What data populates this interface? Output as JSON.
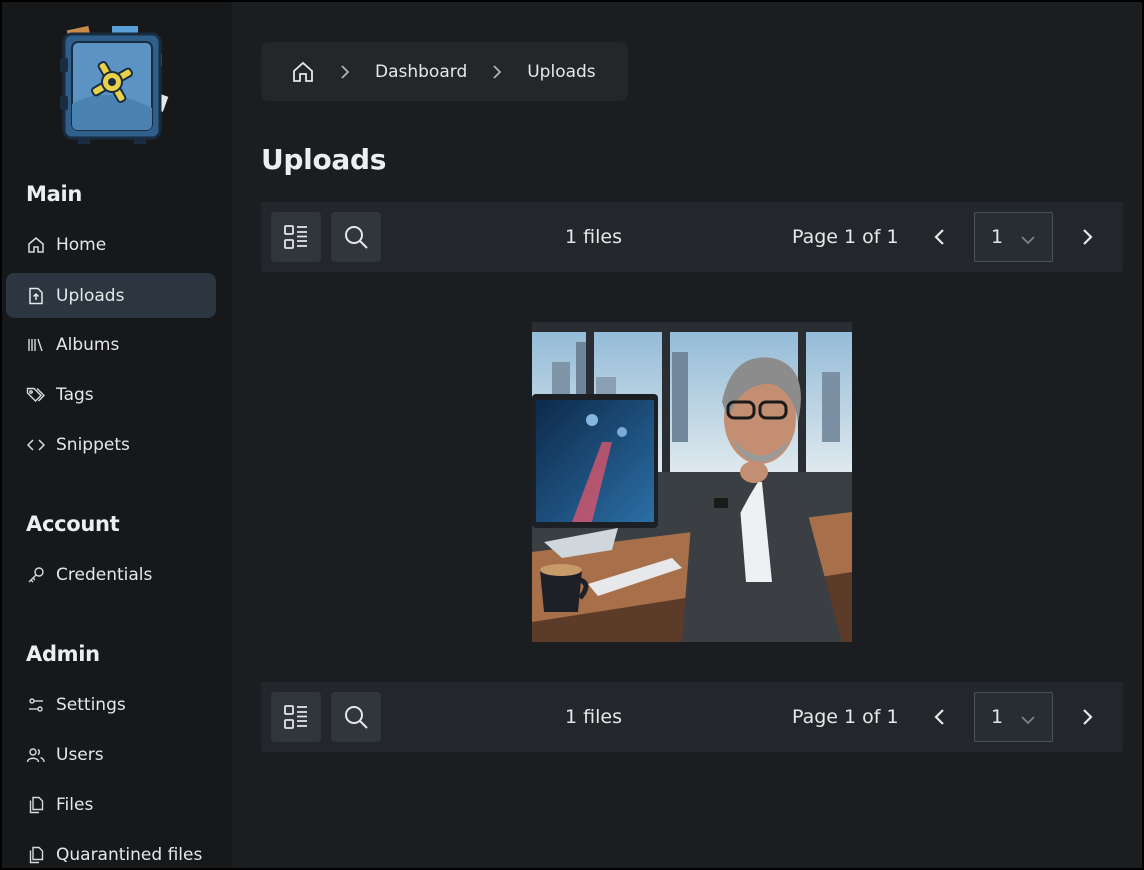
{
  "sidebar": {
    "logo": "vault-safe-logo",
    "sections": {
      "main": "Main",
      "account": "Account",
      "admin": "Admin"
    },
    "items": {
      "home": "Home",
      "uploads": "Uploads",
      "albums": "Albums",
      "tags": "Tags",
      "snippets": "Snippets",
      "credentials": "Credentials",
      "settings": "Settings",
      "users": "Users",
      "files": "Files",
      "quarantined": "Quarantined files"
    },
    "active": "uploads"
  },
  "breadcrumb": {
    "home_icon": "home-icon",
    "items": [
      "Dashboard",
      "Uploads"
    ]
  },
  "page": {
    "title": "Uploads"
  },
  "toolbar": {
    "view_icon": "list-view-icon",
    "search_icon": "search-icon",
    "count": "1 files",
    "page_label": "Page 1 of 1",
    "page_select_value": "1"
  },
  "colors": {
    "background": "#1b1e20",
    "sidebar": "#16181a",
    "active_item": "#2c3640",
    "toolbar": "#23262a",
    "button": "#30363c"
  }
}
